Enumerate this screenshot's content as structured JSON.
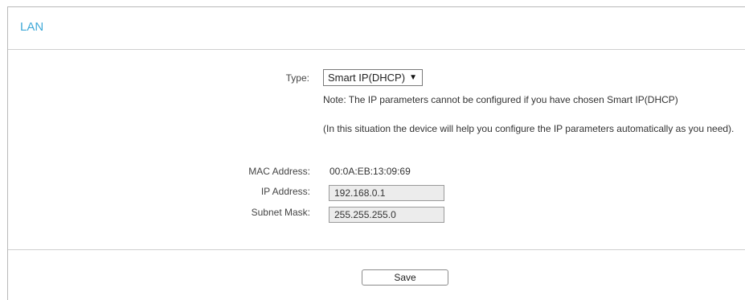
{
  "panel": {
    "title": "LAN"
  },
  "type": {
    "label": "Type:",
    "selected": "Smart IP(DHCP)",
    "arrow": "▼"
  },
  "notes": {
    "line1": "Note: The IP parameters cannot be configured if you have chosen Smart IP(DHCP)",
    "line2": "(In this situation the device will help you configure the IP parameters automatically as you need)."
  },
  "mac": {
    "label": "MAC Address:",
    "value": "00:0A:EB:13:09:69"
  },
  "ip": {
    "label": "IP Address:",
    "value": "192.168.0.1"
  },
  "subnet": {
    "label": "Subnet Mask:",
    "value": "255.255.255.0"
  },
  "actions": {
    "save_label": "Save"
  },
  "colors": {
    "title": "#3fa9d8",
    "input_background": "#ececec"
  },
  "icons": {
    "dropdown": "caret-down-icon"
  }
}
